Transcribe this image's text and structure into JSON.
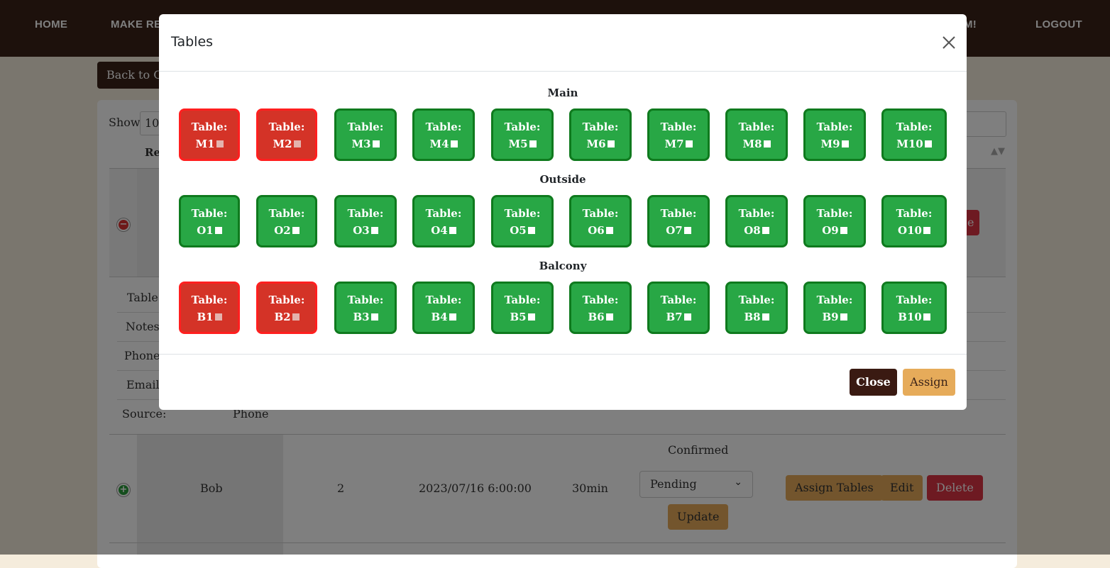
{
  "nav": {
    "home": "HOME",
    "make_reservation": "MAKE RES",
    "hidden_item": "M!",
    "logout": "LOGOUT"
  },
  "page": {
    "back_button": "Back to Ca",
    "show_label": "Show",
    "show_value": "10",
    "column_header": "Res",
    "details": {
      "table_label": "Table:",
      "notes_label": "Notes:",
      "phone_label": "Phone:",
      "email_label": "Email:",
      "source_label": "Source:",
      "source_value": "Phone"
    },
    "row1_delete_fragment": "e",
    "row2": {
      "name": "Bob",
      "party_size": "2",
      "datetime": "2023/07/16 6:00:00",
      "duration": "30min",
      "status_text": "Confirmed",
      "status_select": "Pending",
      "update_button": "Update",
      "assign_button": "Assign Tables",
      "edit_button": "Edit",
      "delete_button": "Delete"
    }
  },
  "modal": {
    "title": "Tables",
    "sections": [
      {
        "name": "Main",
        "tables": [
          {
            "label": "Table:",
            "id": "M1",
            "booked": true
          },
          {
            "label": "Table:",
            "id": "M2",
            "booked": true
          },
          {
            "label": "Table:",
            "id": "M3",
            "booked": false
          },
          {
            "label": "Table:",
            "id": "M4",
            "booked": false
          },
          {
            "label": "Table:",
            "id": "M5",
            "booked": false
          },
          {
            "label": "Table:",
            "id": "M6",
            "booked": false
          },
          {
            "label": "Table:",
            "id": "M7",
            "booked": false
          },
          {
            "label": "Table:",
            "id": "M8",
            "booked": false
          },
          {
            "label": "Table:",
            "id": "M9",
            "booked": false
          },
          {
            "label": "Table:",
            "id": "M10",
            "booked": false
          }
        ]
      },
      {
        "name": "Outside",
        "tables": [
          {
            "label": "Table:",
            "id": "O1",
            "booked": false
          },
          {
            "label": "Table:",
            "id": "O2",
            "booked": false
          },
          {
            "label": "Table:",
            "id": "O3",
            "booked": false
          },
          {
            "label": "Table:",
            "id": "O4",
            "booked": false
          },
          {
            "label": "Table:",
            "id": "O5",
            "booked": false
          },
          {
            "label": "Table:",
            "id": "O6",
            "booked": false
          },
          {
            "label": "Table:",
            "id": "O7",
            "booked": false
          },
          {
            "label": "Table:",
            "id": "O8",
            "booked": false
          },
          {
            "label": "Table:",
            "id": "O9",
            "booked": false
          },
          {
            "label": "Table:",
            "id": "O10",
            "booked": false
          }
        ]
      },
      {
        "name": "Balcony",
        "tables": [
          {
            "label": "Table:",
            "id": "B1",
            "booked": true
          },
          {
            "label": "Table:",
            "id": "B2",
            "booked": true
          },
          {
            "label": "Table:",
            "id": "B3",
            "booked": false
          },
          {
            "label": "Table:",
            "id": "B4",
            "booked": false
          },
          {
            "label": "Table:",
            "id": "B5",
            "booked": false
          },
          {
            "label": "Table:",
            "id": "B6",
            "booked": false
          },
          {
            "label": "Table:",
            "id": "B7",
            "booked": false
          },
          {
            "label": "Table:",
            "id": "B8",
            "booked": false
          },
          {
            "label": "Table:",
            "id": "B9",
            "booked": false
          },
          {
            "label": "Table:",
            "id": "B10",
            "booked": false
          }
        ]
      }
    ],
    "close_button": "Close",
    "assign_button": "Assign"
  },
  "colors": {
    "brand_dark": "#3a2218",
    "accent": "#e6ab5a",
    "available": "#28a745",
    "booked": "#d43327",
    "danger": "#dc3545"
  },
  "icons": [
    "close-icon",
    "minus-circle-icon",
    "plus-circle-icon",
    "chevron-down-icon",
    "sort-icon"
  ]
}
